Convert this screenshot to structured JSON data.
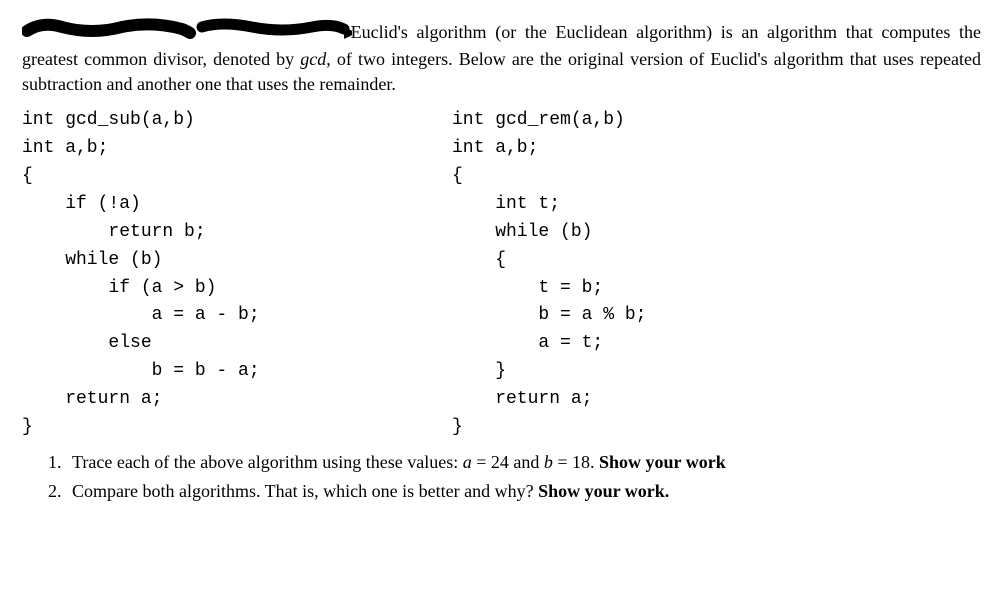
{
  "intro": {
    "after_redaction": " Euclid's algorithm (or the Euclidean algorithm) is an algorithm",
    "rest": "that computes the greatest common divisor, denoted by ",
    "gcd_word": "gcd",
    "rest2": ", of two integers. Below are the original version of Euclid's algorithm that uses repeated subtraction and another one that uses the remainder."
  },
  "code": {
    "left": "int gcd_sub(a,b)\nint a,b;\n{\n    if (!a)\n        return b;\n    while (b)\n        if (a > b)\n            a = a - b;\n        else\n            b = b - a;\n    return a;\n}",
    "right": "int gcd_rem(a,b)\nint a,b;\n{\n    int t;\n    while (b)\n    {\n        t = b;\n        b = a % b;\n        a = t;\n    }\n    return a;\n}"
  },
  "questions": {
    "q1_pre": "Trace each of the above algorithm using these values: ",
    "q1_a": "a",
    "q1_eq1": " = 24 and ",
    "q1_b": "b",
    "q1_eq2": " = 18. ",
    "q1_bold": "Show your work",
    "q2_pre": "Compare both algorithms. That is, which one is better and why? ",
    "q2_bold": "Show your work."
  }
}
